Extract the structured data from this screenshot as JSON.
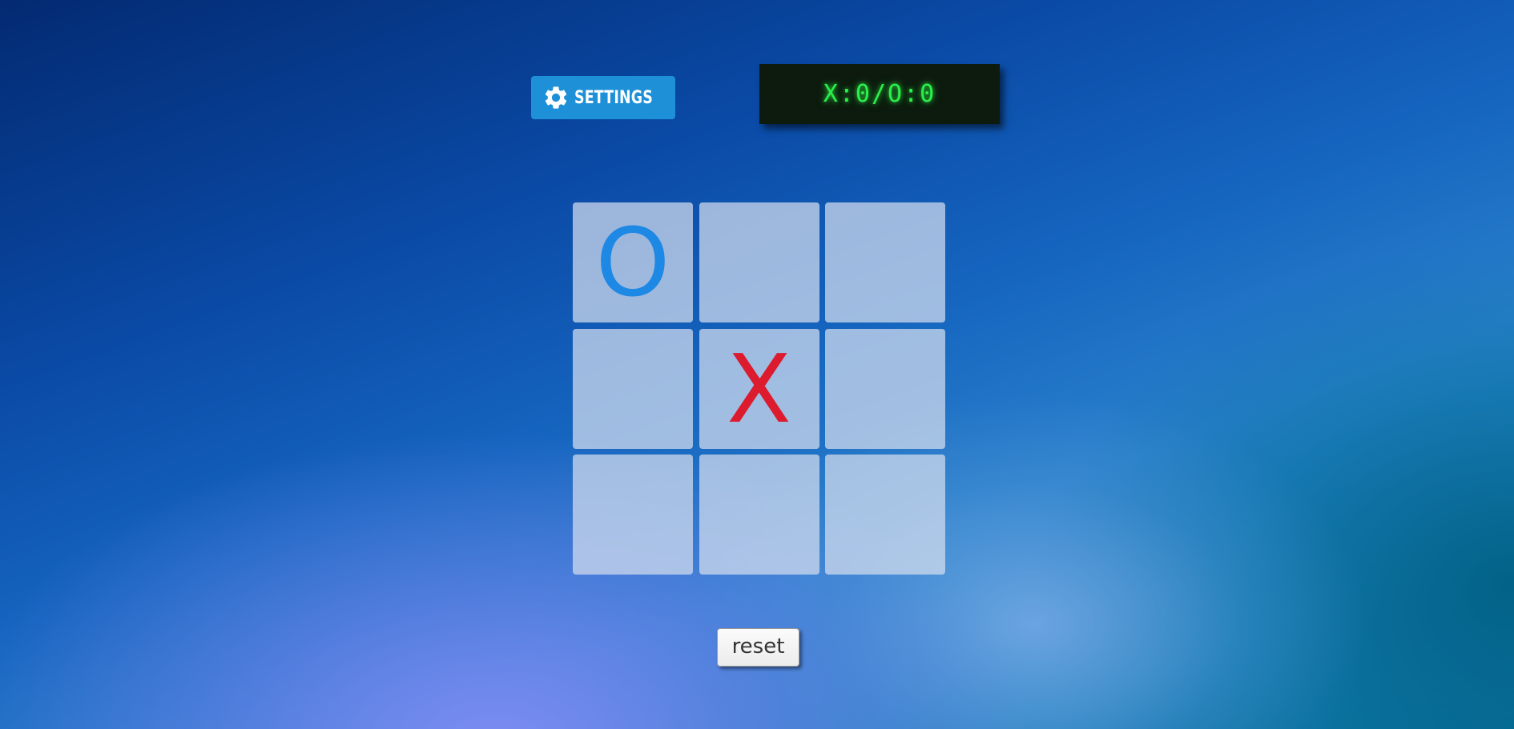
{
  "toolbar": {
    "settings_label": "SETTINGS",
    "settings_icon": "gear-icon"
  },
  "scoreboard": {
    "text": "X:0/O:0",
    "x_score": 0,
    "o_score": 0,
    "text_color": "#2cf04a"
  },
  "board": {
    "cells": [
      "O",
      "",
      "",
      "",
      "X",
      "",
      "",
      "",
      ""
    ],
    "colors": {
      "O": "#1e88e5",
      "X": "#dc1b2e"
    }
  },
  "controls": {
    "reset_label": "reset"
  }
}
